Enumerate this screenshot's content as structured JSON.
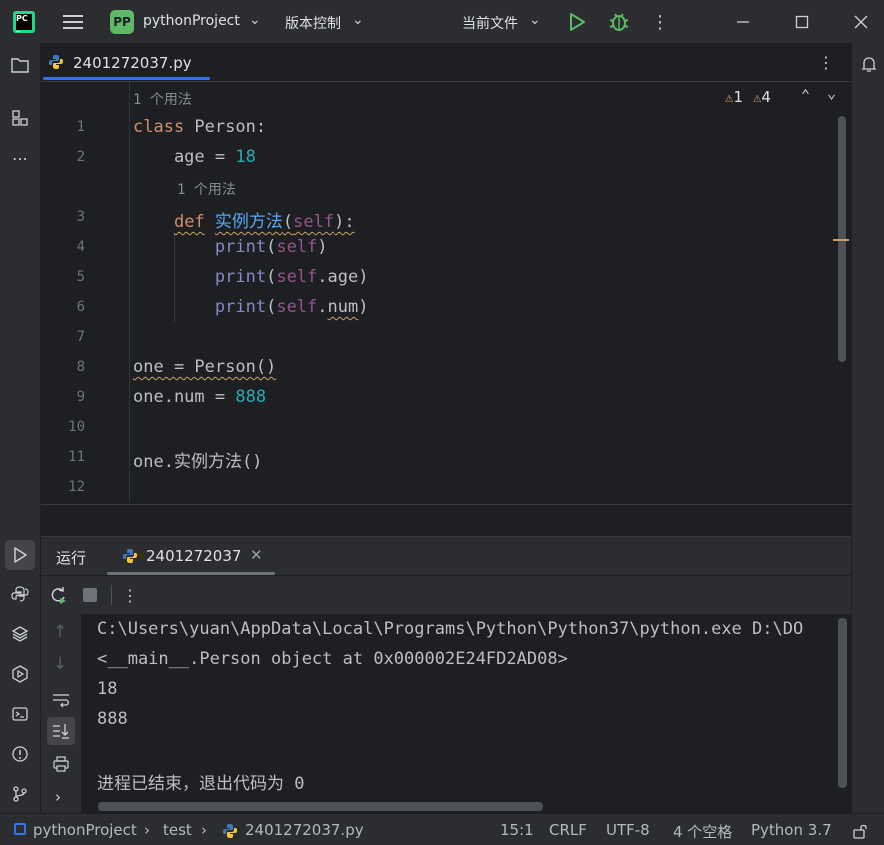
{
  "titlebar": {
    "project_badge": "PP",
    "project_name": "pythonProject",
    "vcs_label": "版本控制",
    "run_config": "当前文件"
  },
  "editor": {
    "tab_name": "2401272037.py",
    "usage_hint_top": "1 个用法",
    "usage_hint_method": "1 个用法",
    "error_count": "1",
    "warning_count": "4",
    "line_numbers": [
      "1",
      "2",
      "3",
      "4",
      "5",
      "6",
      "7",
      "8",
      "9",
      "10",
      "11",
      "12"
    ]
  },
  "run_panel": {
    "tab_run": "运行",
    "tab_file": "2401272037",
    "output_lines": [
      "C:\\Users\\yuan\\AppData\\Local\\Programs\\Python\\Python37\\python.exe D:\\DO",
      "<__main__.Person object at 0x000002E24FD2AD08>",
      "18",
      "888",
      "",
      "进程已结束，退出代码为 0"
    ]
  },
  "statusbar": {
    "project": "pythonProject",
    "folder": "test",
    "file": "2401272037.py",
    "position": "15:1",
    "line_sep": "CRLF",
    "encoding": "UTF-8",
    "indent": "4 个空格",
    "interpreter": "Python 3.7"
  },
  "colors": {
    "accent": "#3574f0",
    "keyword": "#cf8e6d",
    "number": "#2aacb8",
    "self": "#94558d",
    "function": "#56a8f5",
    "run_green": "#5fb865",
    "warning": "#e0b453"
  }
}
